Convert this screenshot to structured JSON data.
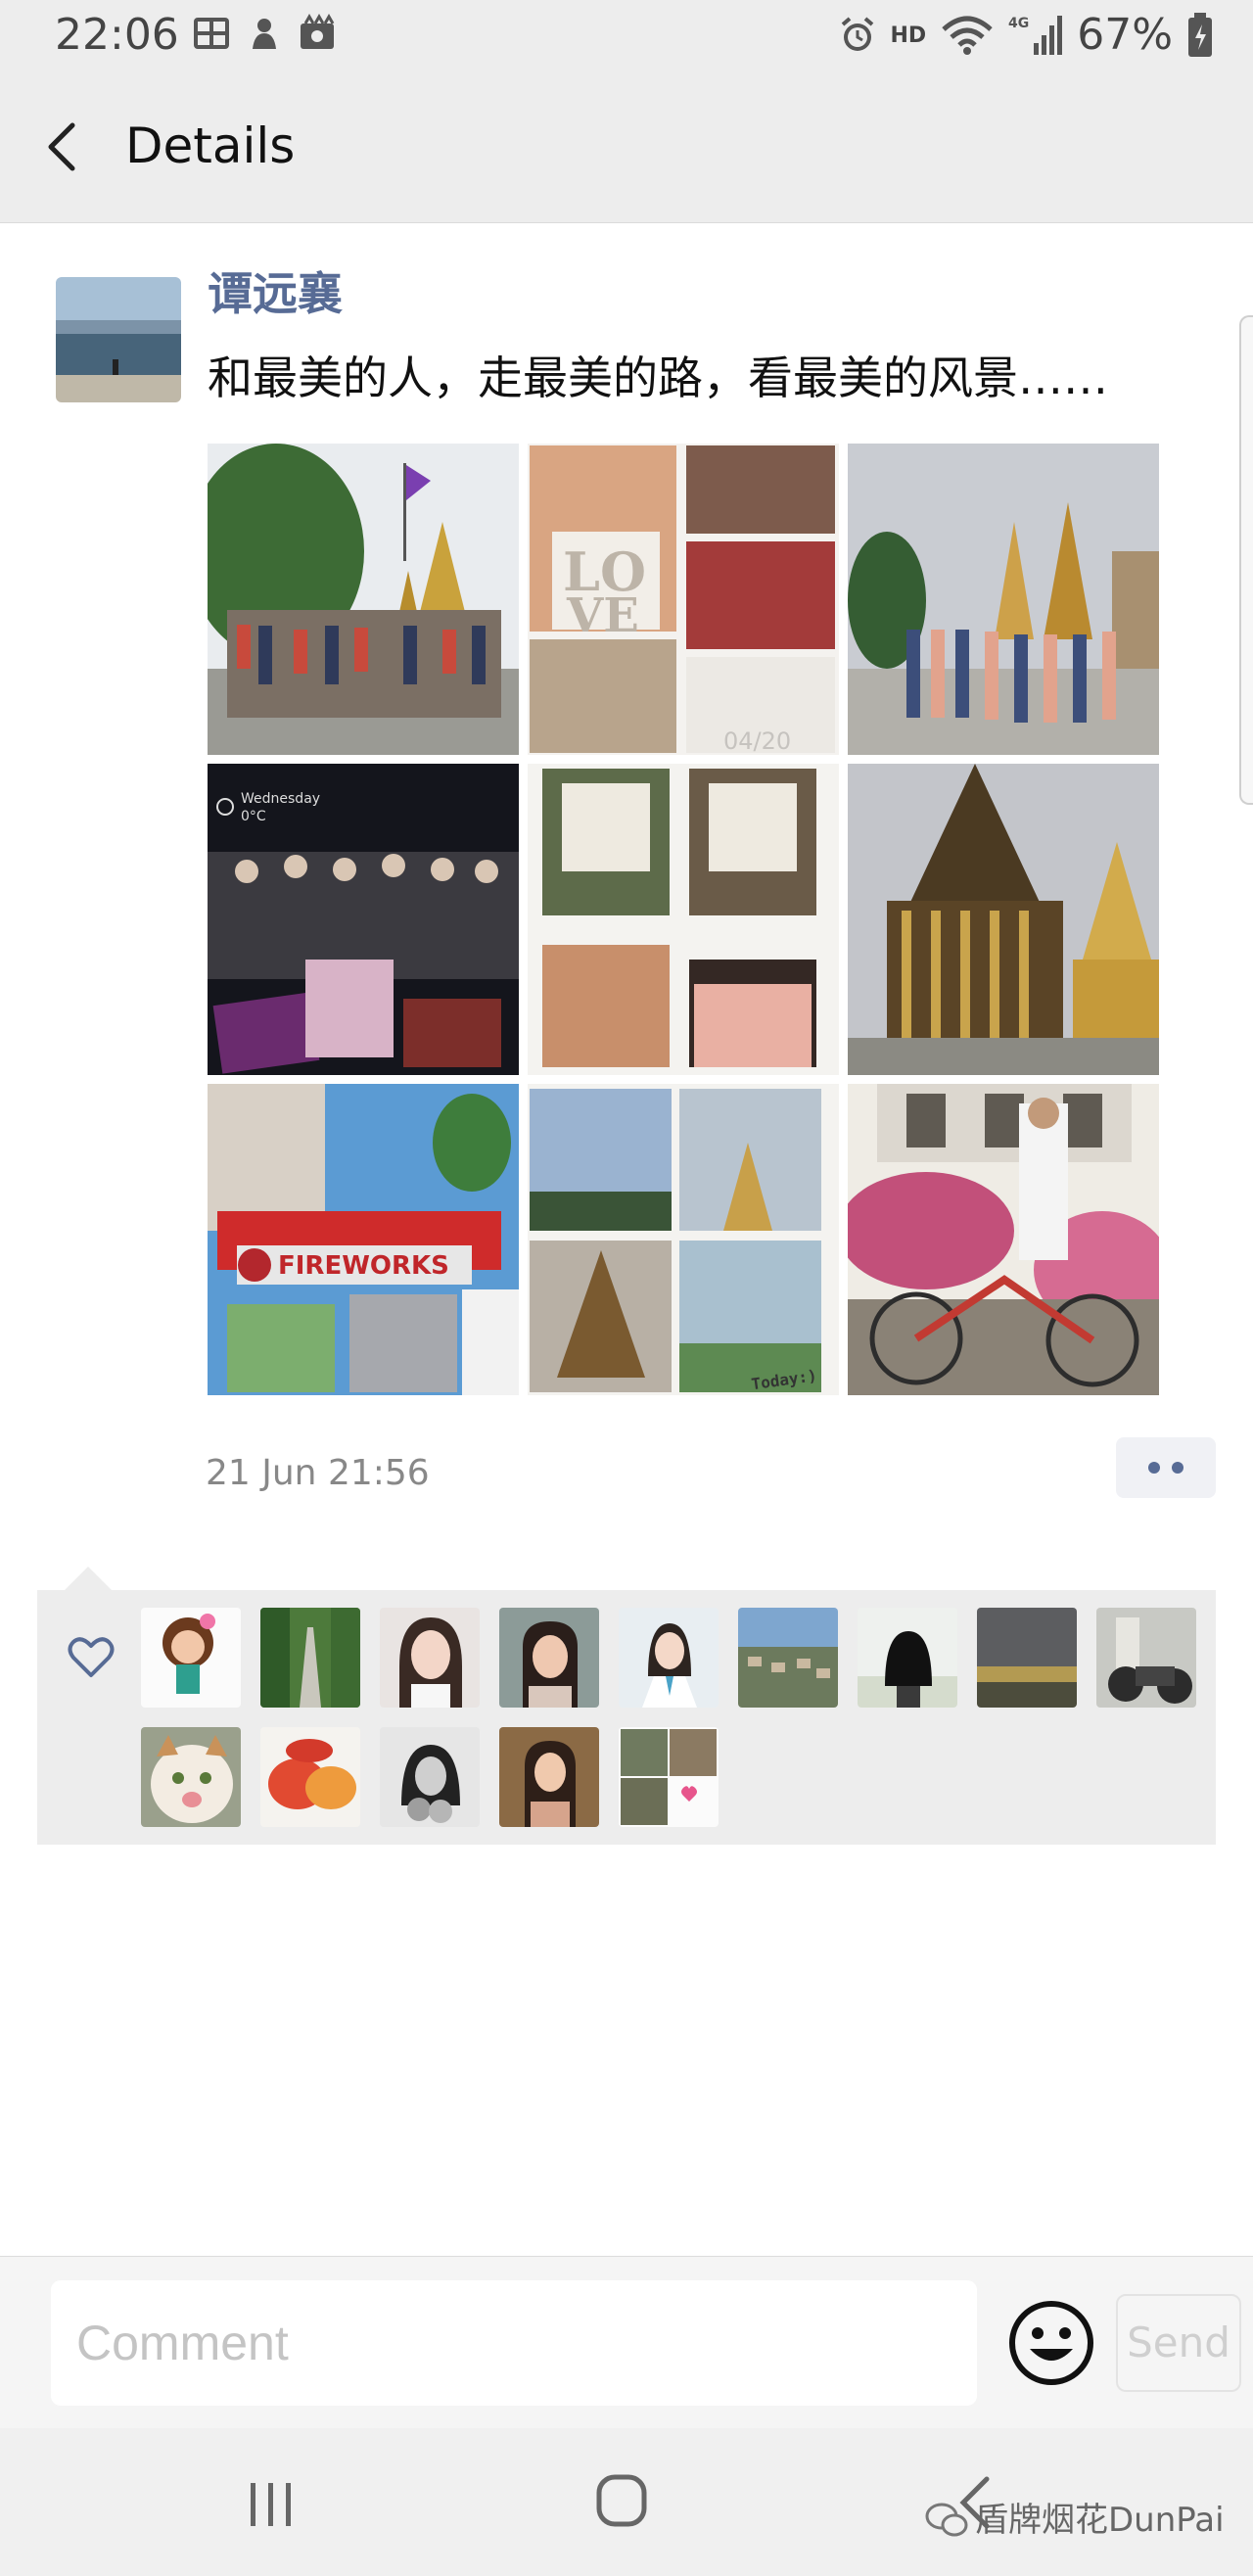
{
  "status_bar": {
    "time": "22:06",
    "hd": "HD",
    "network": "4G",
    "battery": "67%",
    "left_icons": [
      "grid-app-icon",
      "notification-icon",
      "gallery-icon"
    ],
    "right_icons": [
      "alarm-icon",
      "wifi-icon",
      "signal-icon",
      "battery-icon"
    ]
  },
  "nav": {
    "title": "Details",
    "back_icon": "chevron-left-icon"
  },
  "post": {
    "author": "谭远襄",
    "text": "和最美的人，走最美的路，看最美的风景……",
    "timestamp": "21 Jun 21:56",
    "photos": [
      "group-photo-temple-flag",
      "collage-love-sculpture",
      "group-photo-temple-spires",
      "night-group-collage",
      "window-collage",
      "golden-temple",
      "fireworks-group-red-shirts",
      "sky-temple-collage",
      "bicycle-flowers"
    ],
    "photo_collage_text": [
      "Wednesday",
      "0°C",
      "FIREWORKS",
      "Today:)",
      "04/20"
    ]
  },
  "likes": {
    "heart_icon": "heart-outline-icon",
    "count_shown": 14
  },
  "comment_bar": {
    "placeholder": "Comment",
    "emoji_icon": "smiley-icon",
    "send_label": "Send"
  },
  "system_nav": {
    "recent_icon": "recent-apps-icon",
    "home_icon": "home-icon",
    "back_icon": "system-back-icon"
  },
  "watermark": {
    "text": "盾牌烟花DunPai"
  },
  "colors": {
    "link_name": "#576b95",
    "bar_gray": "#ededed",
    "send_disabled": "#cfcfcf"
  }
}
